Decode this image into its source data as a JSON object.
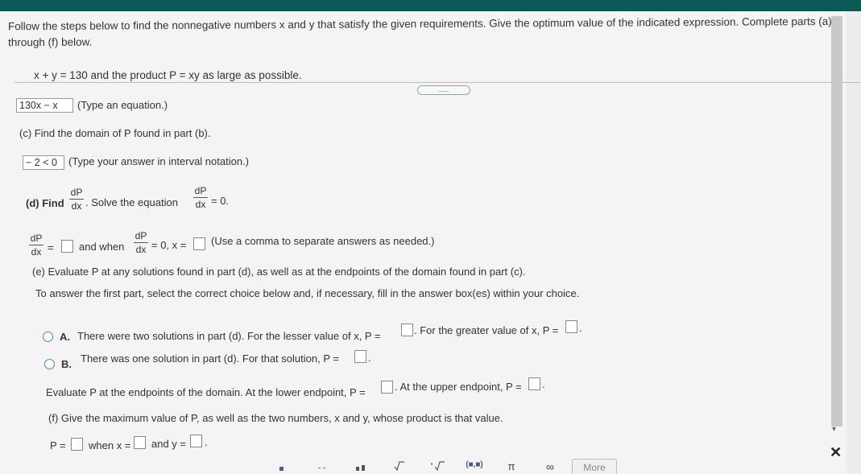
{
  "instructions": "Follow the steps below to find the nonnegative numbers x and y that satisfy the given requirements. Give the optimum value of the indicated expression. Complete parts (a) through (f) below.",
  "problem": "x + y = 130 and the product P = xy as large as possible.",
  "expand_label": ".....",
  "part_b": {
    "answer": "130x − x",
    "hint": "(Type an equation.)"
  },
  "part_c": {
    "prompt": "(c) Find the domain of P found in part (b).",
    "answer": "− 2 < 0",
    "hint": "(Type your answer in interval notation.)"
  },
  "part_d": {
    "label": "(d) Find",
    "solve_text": ". Solve the equation",
    "equals_zero": "= 0.",
    "frac_num": "dP",
    "frac_den": "dx",
    "eq_sign": "=",
    "and_when": "and when",
    "eq_zero_x": "= 0, x =",
    "hint": "(Use a comma to separate answers as needed.)"
  },
  "part_e": {
    "prompt": "(e) Evaluate P at any solutions found in part (d), as well as at the endpoints of the domain found in part (c).",
    "choice_instr": "To answer the first part, select the correct choice below and, if necessary, fill in the answer box(es) within your choice.",
    "option_a_letter": "A.",
    "option_a_text1": "There were two solutions in part (d). For the lesser value of x, P =",
    "option_a_text2": ". For the greater value of x, P =",
    "option_b_letter": "B.",
    "option_b_text": "There was one solution in part (d). For that solution, P =",
    "endpoints_text1": "Evaluate P at the endpoints of the domain. At the lower endpoint, P =",
    "endpoints_text2": ". At the upper endpoint, P =",
    "period": "."
  },
  "part_f": {
    "prompt": "(f) Give the maximum value of P, as well as the two numbers, x and y, whose product is that value.",
    "p_eq": "P =",
    "when_x": "when x =",
    "and_y": "and y =",
    "period": "."
  },
  "toolbar": {
    "btn_pi": "π",
    "btn_inf": "∞",
    "btn_more": "More",
    "btn_interval": "(■,■)"
  },
  "icons": [
    "fraction-icon",
    "mixed-number-icon",
    "exponent-icon",
    "sqrt-icon",
    "nth-root-icon",
    "interval-icon",
    "pi-icon",
    "infinity-icon",
    "close-icon"
  ],
  "colors": {
    "header": "#0c5a55",
    "radio": "#3a8dc0"
  }
}
